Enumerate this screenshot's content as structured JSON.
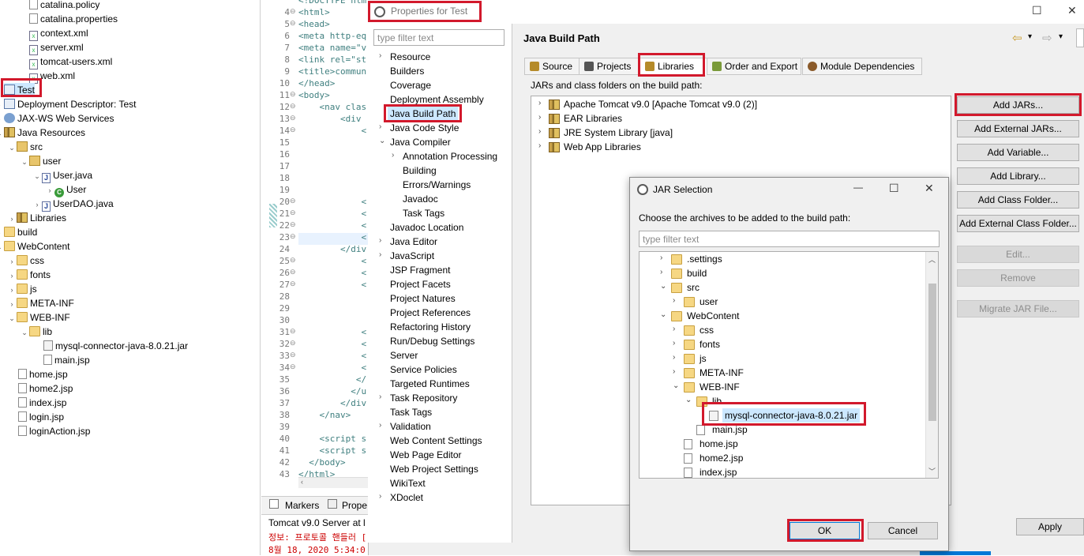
{
  "explorer": {
    "rows": [
      {
        "label": "catalina.policy",
        "icon": "file-icon"
      },
      {
        "label": "catalina.properties",
        "icon": "file-icon"
      },
      {
        "label": "context.xml",
        "icon": "xml-file-icon"
      },
      {
        "label": "server.xml",
        "icon": "xml-file-icon"
      },
      {
        "label": "tomcat-users.xml",
        "icon": "xml-file-icon"
      },
      {
        "label": "web.xml",
        "icon": "xml-file-icon"
      },
      {
        "label": "Test",
        "icon": "project-icon"
      },
      {
        "label": "Deployment Descriptor: Test",
        "icon": "deployment-descriptor-icon"
      },
      {
        "label": "JAX-WS Web Services",
        "icon": "web-services-icon"
      },
      {
        "label": "Java Resources",
        "icon": "java-resources-icon"
      },
      {
        "label": "src",
        "icon": "source-folder-icon"
      },
      {
        "label": "user",
        "icon": "package-icon"
      },
      {
        "label": "User.java",
        "icon": "java-file-icon"
      },
      {
        "label": "User",
        "icon": "class-icon"
      },
      {
        "label": "UserDAO.java",
        "icon": "java-file-icon"
      },
      {
        "label": "Libraries",
        "icon": "library-icon"
      },
      {
        "label": "build",
        "icon": "folder-icon"
      },
      {
        "label": "WebContent",
        "icon": "folder-icon"
      },
      {
        "label": "css",
        "icon": "folder-icon"
      },
      {
        "label": "fonts",
        "icon": "folder-icon"
      },
      {
        "label": "js",
        "icon": "folder-icon"
      },
      {
        "label": "META-INF",
        "icon": "folder-icon"
      },
      {
        "label": "WEB-INF",
        "icon": "folder-icon"
      },
      {
        "label": "lib",
        "icon": "folder-icon"
      },
      {
        "label": "mysql-connector-java-8.0.21.jar",
        "icon": "jar-file-icon"
      },
      {
        "label": "main.jsp",
        "icon": "file-icon"
      },
      {
        "label": "home.jsp",
        "icon": "file-icon"
      },
      {
        "label": "home2.jsp",
        "icon": "file-icon"
      },
      {
        "label": "index.jsp",
        "icon": "file-icon"
      },
      {
        "label": "login.jsp",
        "icon": "file-icon"
      },
      {
        "label": "loginAction.jsp",
        "icon": "file-icon"
      }
    ]
  },
  "editor": {
    "lines": [
      {
        "n": "",
        "code": "<!DOCTYPE html>"
      },
      {
        "n": "4",
        "code": "<html>"
      },
      {
        "n": "5",
        "code": "<head>"
      },
      {
        "n": "6",
        "code": "<meta http-eq"
      },
      {
        "n": "7",
        "code": "<meta name=\"v"
      },
      {
        "n": "8",
        "code": "<link rel=\"st"
      },
      {
        "n": "9",
        "code": "<title>commun"
      },
      {
        "n": "10",
        "code": "</head>"
      },
      {
        "n": "11",
        "code": "<body>"
      },
      {
        "n": "12",
        "code": "    <nav clas"
      },
      {
        "n": "13",
        "code": "        <div"
      },
      {
        "n": "14",
        "code": "            <"
      },
      {
        "n": "15",
        "code": ""
      },
      {
        "n": "16",
        "code": ""
      },
      {
        "n": "17",
        "code": ""
      },
      {
        "n": "18",
        "code": ""
      },
      {
        "n": "19",
        "code": ""
      },
      {
        "n": "20",
        "code": "            <"
      },
      {
        "n": "21",
        "code": "            <"
      },
      {
        "n": "22",
        "code": "            <"
      },
      {
        "n": "23",
        "code": "            <"
      },
      {
        "n": "24",
        "code": "        </div"
      },
      {
        "n": "25",
        "code": "            <"
      },
      {
        "n": "26",
        "code": "            <"
      },
      {
        "n": "27",
        "code": "            <"
      },
      {
        "n": "28",
        "code": ""
      },
      {
        "n": "29",
        "code": ""
      },
      {
        "n": "30",
        "code": ""
      },
      {
        "n": "31",
        "code": "            <"
      },
      {
        "n": "32",
        "code": "            <"
      },
      {
        "n": "33",
        "code": "            <"
      },
      {
        "n": "34",
        "code": "            <"
      },
      {
        "n": "35",
        "code": "           </"
      },
      {
        "n": "36",
        "code": "          </u"
      },
      {
        "n": "37",
        "code": "        </div"
      },
      {
        "n": "38",
        "code": "    </nav>"
      },
      {
        "n": "39",
        "code": ""
      },
      {
        "n": "40",
        "code": "    <script s"
      },
      {
        "n": "41",
        "code": "    <script s"
      },
      {
        "n": "42",
        "code": "  </body>"
      },
      {
        "n": "43",
        "code": "</html>"
      }
    ],
    "tabs": [
      "Markers",
      "Prope"
    ],
    "console_title": "Tomcat v9.0 Server at l",
    "console_lines": [
      "정보: 프로토콜 핸들러 [\"",
      "8월 18, 2020 5:34:0"
    ]
  },
  "properties": {
    "title": "Properties for Test",
    "filter_placeholder": "type filter text",
    "nav": [
      {
        "label": "Resource",
        "indent": 0,
        "toggle": "›"
      },
      {
        "label": "Builders",
        "indent": 0,
        "toggle": ""
      },
      {
        "label": "Coverage",
        "indent": 0,
        "toggle": ""
      },
      {
        "label": "Deployment Assembly",
        "indent": 0,
        "toggle": ""
      },
      {
        "label": "Java Build Path",
        "indent": 0,
        "toggle": ""
      },
      {
        "label": "Java Code Style",
        "indent": 0,
        "toggle": "›"
      },
      {
        "label": "Java Compiler",
        "indent": 0,
        "toggle": "⌄"
      },
      {
        "label": "Annotation Processing",
        "indent": 1,
        "toggle": "›"
      },
      {
        "label": "Building",
        "indent": 1,
        "toggle": ""
      },
      {
        "label": "Errors/Warnings",
        "indent": 1,
        "toggle": ""
      },
      {
        "label": "Javadoc",
        "indent": 1,
        "toggle": ""
      },
      {
        "label": "Task Tags",
        "indent": 1,
        "toggle": ""
      },
      {
        "label": "Javadoc Location",
        "indent": 0,
        "toggle": ""
      },
      {
        "label": "Java Editor",
        "indent": 0,
        "toggle": "›"
      },
      {
        "label": "JavaScript",
        "indent": 0,
        "toggle": "›"
      },
      {
        "label": "JSP Fragment",
        "indent": 0,
        "toggle": ""
      },
      {
        "label": "Project Facets",
        "indent": 0,
        "toggle": ""
      },
      {
        "label": "Project Natures",
        "indent": 0,
        "toggle": ""
      },
      {
        "label": "Project References",
        "indent": 0,
        "toggle": ""
      },
      {
        "label": "Refactoring History",
        "indent": 0,
        "toggle": ""
      },
      {
        "label": "Run/Debug Settings",
        "indent": 0,
        "toggle": ""
      },
      {
        "label": "Server",
        "indent": 0,
        "toggle": ""
      },
      {
        "label": "Service Policies",
        "indent": 0,
        "toggle": ""
      },
      {
        "label": "Targeted Runtimes",
        "indent": 0,
        "toggle": ""
      },
      {
        "label": "Task Repository",
        "indent": 0,
        "toggle": "›"
      },
      {
        "label": "Task Tags",
        "indent": 0,
        "toggle": ""
      },
      {
        "label": "Validation",
        "indent": 0,
        "toggle": "›"
      },
      {
        "label": "Web Content Settings",
        "indent": 0,
        "toggle": ""
      },
      {
        "label": "Web Page Editor",
        "indent": 0,
        "toggle": ""
      },
      {
        "label": "Web Project Settings",
        "indent": 0,
        "toggle": ""
      },
      {
        "label": "WikiText",
        "indent": 0,
        "toggle": ""
      },
      {
        "label": "XDoclet",
        "indent": 0,
        "toggle": "›"
      }
    ],
    "page_title": "Java Build Path",
    "tabs": [
      "Source",
      "Projects",
      "Libraries",
      "Order and Export",
      "Module Dependencies"
    ],
    "jars_label": "JARs and class folders on the build path:",
    "libraries": [
      "Apache Tomcat v9.0 [Apache Tomcat v9.0 (2)]",
      "EAR Libraries",
      "JRE System Library [java]",
      "Web App Libraries"
    ],
    "buttons": {
      "add_jars": "Add JARs...",
      "add_external_jars": "Add External JARs...",
      "add_variable": "Add Variable...",
      "add_library": "Add Library...",
      "add_class_folder": "Add Class Folder...",
      "add_external_class_folder": "Add External Class Folder...",
      "edit": "Edit...",
      "remove": "Remove",
      "migrate": "Migrate JAR File...",
      "apply": "Apply"
    },
    "window_controls": {
      "maximize": "☐",
      "close": "✕"
    },
    "nav_arrows": {
      "back": "⇦",
      "forward": "⇨",
      "menu": "▾"
    }
  },
  "jar_dialog": {
    "title": "JAR Selection",
    "message": "Choose the archives to be added to the build path:",
    "filter_placeholder": "type filter text",
    "controls": {
      "minimize": "—",
      "maximize": "☐",
      "close": "✕"
    },
    "tree": [
      {
        "label": ".settings",
        "depth": 1,
        "toggle": "›",
        "type": "folder"
      },
      {
        "label": "build",
        "depth": 1,
        "toggle": "›",
        "type": "folder"
      },
      {
        "label": "src",
        "depth": 1,
        "toggle": "⌄",
        "type": "folder"
      },
      {
        "label": "user",
        "depth": 2,
        "toggle": "›",
        "type": "folder"
      },
      {
        "label": "WebContent",
        "depth": 1,
        "toggle": "⌄",
        "type": "folder"
      },
      {
        "label": "css",
        "depth": 2,
        "toggle": "›",
        "type": "folder"
      },
      {
        "label": "fonts",
        "depth": 2,
        "toggle": "›",
        "type": "folder"
      },
      {
        "label": "js",
        "depth": 2,
        "toggle": "›",
        "type": "folder"
      },
      {
        "label": "META-INF",
        "depth": 2,
        "toggle": "›",
        "type": "folder"
      },
      {
        "label": "WEB-INF",
        "depth": 2,
        "toggle": "⌄",
        "type": "folder"
      },
      {
        "label": "lib",
        "depth": 3,
        "toggle": "⌄",
        "type": "folder"
      },
      {
        "label": "mysql-connector-java-8.0.21.jar",
        "depth": 4,
        "toggle": "",
        "type": "jar"
      },
      {
        "label": "main.jsp",
        "depth": 3,
        "toggle": "",
        "type": "file"
      },
      {
        "label": "home.jsp",
        "depth": 2,
        "toggle": "",
        "type": "file"
      },
      {
        "label": "home2.jsp",
        "depth": 2,
        "toggle": "",
        "type": "file"
      },
      {
        "label": "index.jsp",
        "depth": 2,
        "toggle": "",
        "type": "file"
      }
    ],
    "ok_label": "OK",
    "cancel_label": "Cancel"
  },
  "colors": {
    "highlight_red": "#d2192c",
    "selection_blue": "#cce8ff"
  }
}
